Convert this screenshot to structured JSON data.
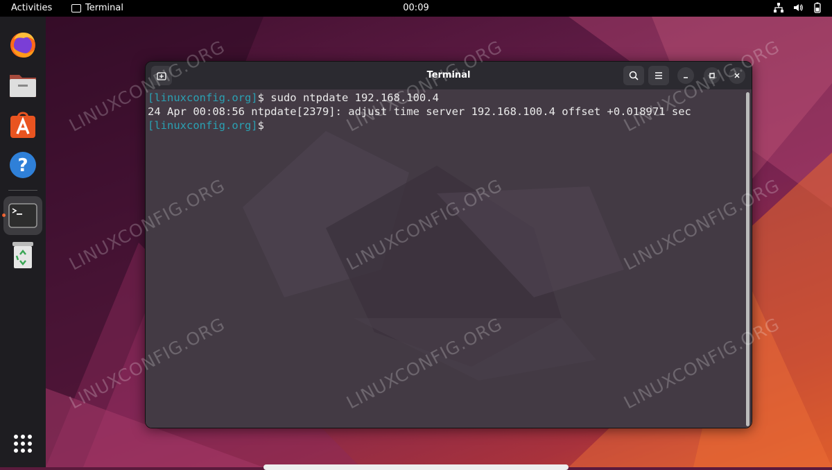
{
  "topbar": {
    "activities": "Activities",
    "app_name": "Terminal",
    "clock": "00:09"
  },
  "window": {
    "title": "Terminal"
  },
  "terminal": {
    "lines": [
      {
        "prompt": "[linuxconfig.org]",
        "text": "$ sudo ntpdate 192.168.100.4"
      },
      {
        "prompt": "",
        "text": "24 Apr 00:08:56 ntpdate[2379]: adjust time server 192.168.100.4 offset +0.018971 sec"
      },
      {
        "prompt": "[linuxconfig.org]",
        "text": "$ "
      }
    ]
  },
  "watermark": "LINUXCONFIG.ORG",
  "dock": {
    "items": [
      "firefox-icon",
      "files-icon",
      "app-center-icon",
      "help-icon",
      "terminal-icon",
      "trash-icon",
      "app-grid-icon"
    ]
  },
  "colors": {
    "prompt": "#2aa1b3",
    "accent": "#e95420",
    "terminal_bg": "#433a44",
    "titlebar": "#2b2a30"
  }
}
